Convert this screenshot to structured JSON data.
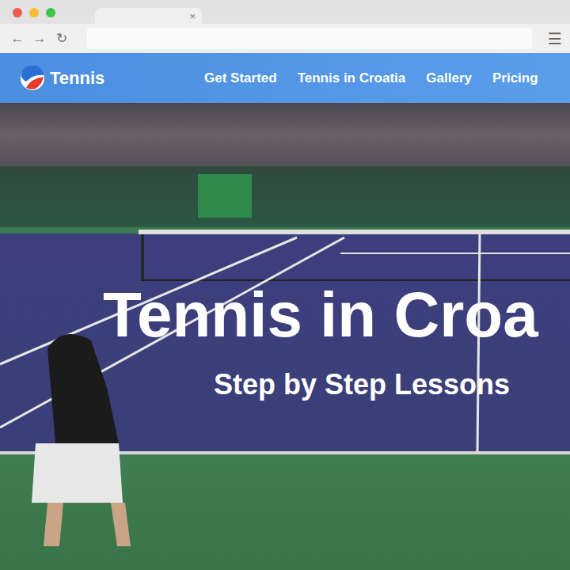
{
  "browser": {
    "controls": [
      "←",
      "→",
      "↻"
    ],
    "tab": {
      "close": "×"
    },
    "menu": "☰"
  },
  "site": {
    "logo": "Tennis",
    "nav": [
      {
        "label": "Get Started"
      },
      {
        "label": "Tennis in Croatia"
      },
      {
        "label": "Gallery"
      },
      {
        "label": "Pricing"
      }
    ]
  },
  "hero": {
    "title": "Tennis in Croa",
    "subtitle": "Step by Step Lessons"
  }
}
